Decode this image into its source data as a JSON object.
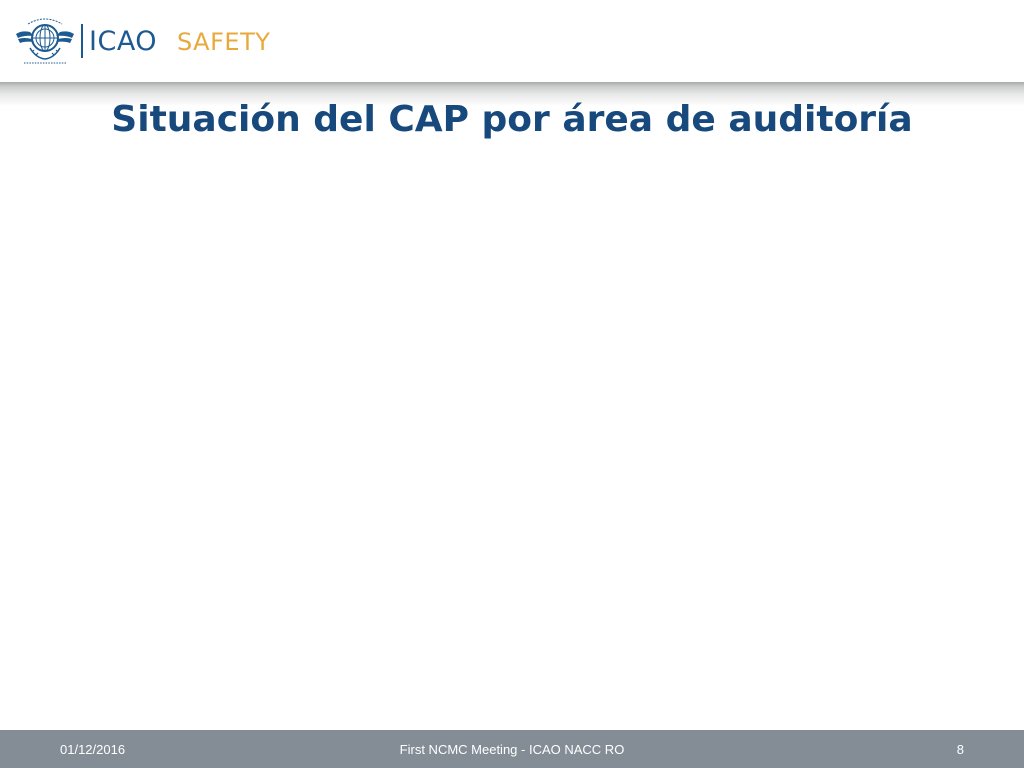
{
  "header": {
    "logo_text": "ICAO",
    "brand_text": "SAFETY",
    "emblem_icon": "icao-emblem-icon",
    "colors": {
      "logo_blue": "#1d5a91",
      "safety_orange": "#e8a93c"
    }
  },
  "slide": {
    "title": "Situación del CAP por área de auditoría",
    "title_color": "#17497d"
  },
  "footer": {
    "date": "01/12/2016",
    "center_text": "First NCMC Meeting - ICAO NACC RO",
    "page_number": "8",
    "background": "#848d96"
  }
}
